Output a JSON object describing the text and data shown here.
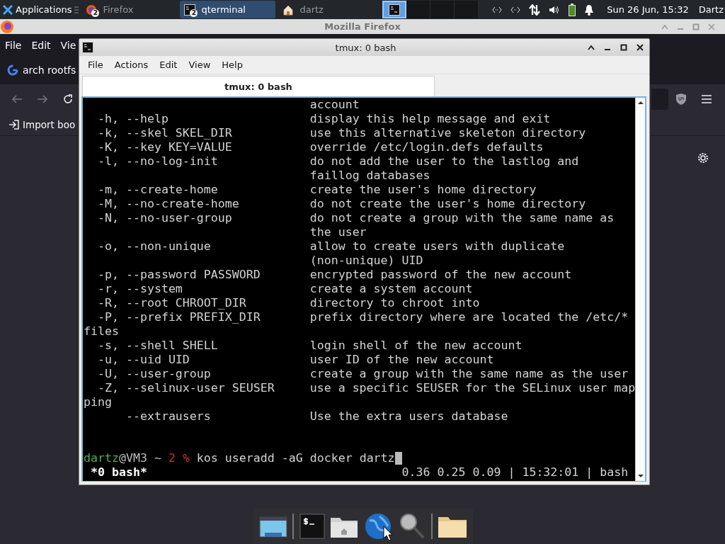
{
  "panel": {
    "apps_label": "Applications",
    "tasks": [
      {
        "label": "Firefox",
        "badge": "2",
        "kind": "firefox",
        "selected": false
      },
      {
        "label": "qterminal",
        "badge": "2",
        "kind": "terminal",
        "selected": true
      },
      {
        "label": "dartz",
        "kind": "home",
        "selected": false
      }
    ],
    "workspaces": [
      {
        "selected": true
      },
      {
        "selected": false
      },
      {
        "selected": false
      },
      {
        "selected": false
      }
    ],
    "clock": "Sun 26 Jun, 15:32",
    "user": "Dartz"
  },
  "browser": {
    "title": "Mozilla Firefox",
    "menu": [
      "File",
      "Edit",
      "Vie"
    ],
    "tab": "arch rootfs",
    "bookmark": "Import boo"
  },
  "terminal": {
    "title": "tmux: 0 bash",
    "menu": [
      "File",
      "Actions",
      "Edit",
      "View",
      "Help"
    ],
    "tabs": [
      {
        "label": "tmux: 0 bash",
        "selected": true
      }
    ],
    "lines": [
      "                                account",
      "  -h, --help                    display this help message and exit",
      "  -k, --skel SKEL_DIR           use this alternative skeleton directory",
      "  -K, --key KEY=VALUE           override /etc/login.defs defaults",
      "  -l, --no-log-init             do not add the user to the lastlog and",
      "                                faillog databases",
      "  -m, --create-home             create the user's home directory",
      "  -M, --no-create-home          do not create the user's home directory",
      "  -N, --no-user-group           do not create a group with the same name as",
      "                                the user",
      "  -o, --non-unique              allow to create users with duplicate",
      "                                (non-unique) UID",
      "  -p, --password PASSWORD       encrypted password of the new account",
      "  -r, --system                  create a system account",
      "  -R, --root CHROOT_DIR         directory to chroot into",
      "  -P, --prefix PREFIX_DIR       prefix directory where are located the /etc/*",
      "files",
      "  -s, --shell SHELL             login shell of the new account",
      "  -u, --uid UID                 user ID of the new account",
      "  -U, --user-group              create a group with the same name as the user",
      "  -Z, --selinux-user SEUSER     use a specific SEUSER for the SELinux user map",
      "ping",
      "      --extrausers              Use the extra users database"
    ],
    "prompt": {
      "user": "dartz",
      "host": "@VM3 ~",
      "count": "2",
      "symbol": "%",
      "command": "kos useradd -aG docker dartz"
    },
    "status_left": "*0 bash*",
    "status_right": "0.36 0.25 0.09 | 15:32:01 | bash"
  },
  "dock": [
    {
      "kind": "desktop"
    },
    {
      "kind": "separator"
    },
    {
      "kind": "terminal"
    },
    {
      "kind": "home-folder"
    },
    {
      "kind": "globe"
    },
    {
      "kind": "search"
    },
    {
      "kind": "separator"
    },
    {
      "kind": "folder"
    }
  ]
}
